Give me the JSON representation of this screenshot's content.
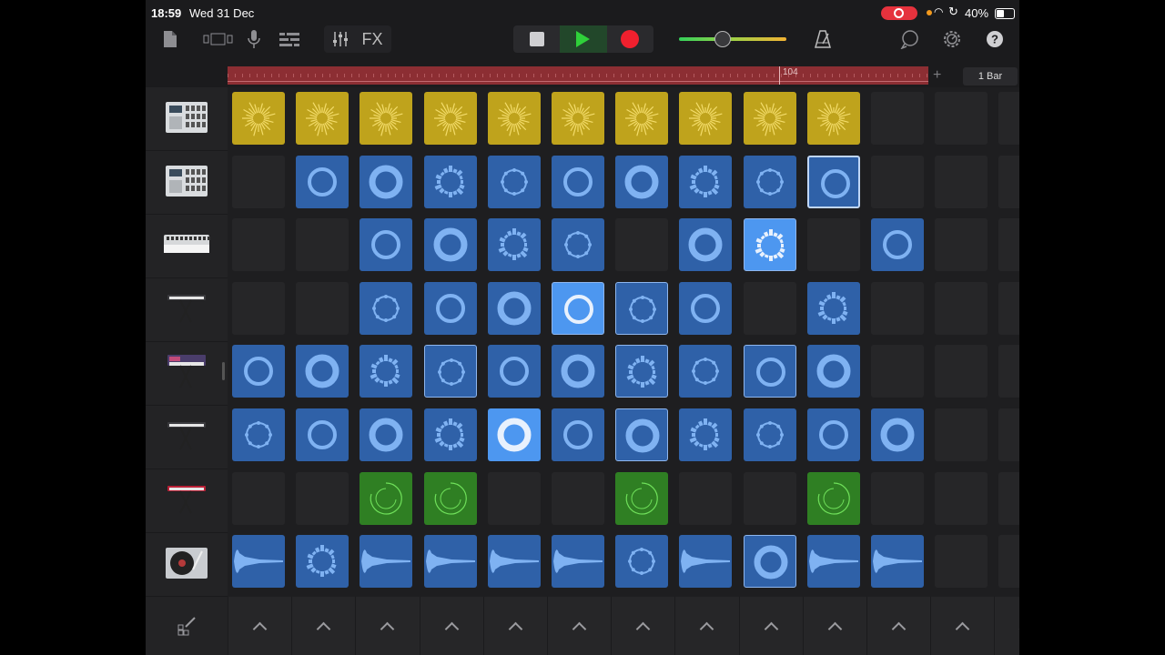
{
  "status": {
    "time": "18:59",
    "date": "Wed 31 Dec",
    "battery": "40%"
  },
  "toolbar": {
    "fx_label": "FX",
    "volume_level": 0.4,
    "icons": [
      "document-icon",
      "track-view-icon",
      "microphone-icon",
      "list-view-icon",
      "mixer-icon",
      "stop-icon",
      "play-icon",
      "record-icon",
      "metronome-icon",
      "loop-browser-icon",
      "settings-icon",
      "help-icon"
    ]
  },
  "ruler": {
    "bar_number": "104",
    "bar_length": "1 Bar",
    "add_label": "+"
  },
  "tracks": [
    {
      "name": "drum-machine",
      "icon": "drum-machine-icon"
    },
    {
      "name": "drum-machine-2",
      "icon": "drum-machine-icon"
    },
    {
      "name": "bass-synth",
      "icon": "bass-synth-icon"
    },
    {
      "name": "keyboard-1",
      "icon": "keyboard-icon"
    },
    {
      "name": "synth",
      "icon": "synth-icon"
    },
    {
      "name": "keyboard-2",
      "icon": "keyboard-icon"
    },
    {
      "name": "red-keyboard",
      "icon": "keyboard-icon"
    },
    {
      "name": "turntable",
      "icon": "turntable-icon"
    }
  ],
  "colors": {
    "blue": "#2f61a8",
    "yellow": "#bfa31c",
    "green": "#2f7f23",
    "lightblue": "#4d97f0"
  },
  "grid": [
    [
      "Y",
      "Y",
      "Y",
      "Y",
      "Y",
      "Y",
      "Y",
      "Y",
      "Y",
      "Y",
      "",
      "",
      ""
    ],
    [
      "",
      "B",
      "B",
      "B",
      "B",
      "B",
      "B",
      "B",
      "B",
      "B",
      "",
      "",
      ""
    ],
    [
      "",
      "",
      "B",
      "B",
      "B",
      "B",
      "",
      "B",
      "L",
      "",
      "B",
      "",
      ""
    ],
    [
      "",
      "",
      "B",
      "B",
      "B",
      "L",
      "B",
      "B",
      "",
      "B",
      "",
      "",
      ""
    ],
    [
      "B",
      "B",
      "B",
      "B",
      "B",
      "B",
      "B",
      "B",
      "B",
      "B",
      "",
      "",
      ""
    ],
    [
      "B",
      "B",
      "B",
      "B",
      "L",
      "B",
      "B",
      "B",
      "B",
      "B",
      "B",
      "",
      ""
    ],
    [
      "",
      "",
      "G",
      "G",
      "",
      "",
      "G",
      "",
      "",
      "G",
      "",
      "",
      ""
    ],
    [
      "W",
      "B",
      "W",
      "W",
      "W",
      "W",
      "B",
      "W",
      "B",
      "W",
      "W",
      "",
      ""
    ]
  ],
  "column_count": 13
}
